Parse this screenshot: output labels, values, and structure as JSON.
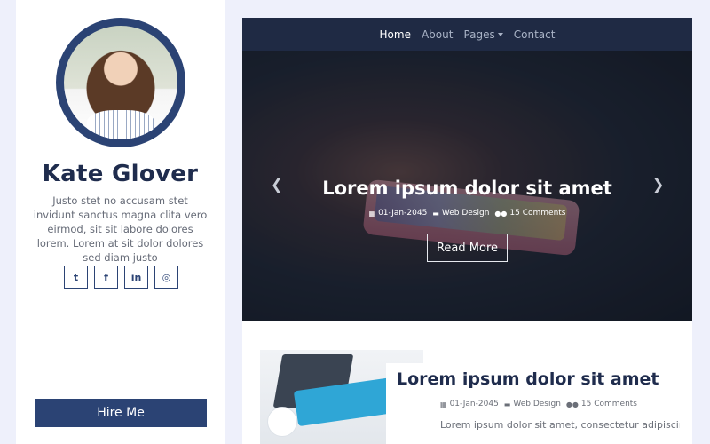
{
  "profile": {
    "name": "Kate Glover",
    "bio": "Justo stet no accusam stet invidunt sanctus magna clita vero eirmod, sit sit labore dolores lorem. Lorem at sit dolor dolores sed diam justo",
    "avatar": "profile-photo"
  },
  "socials": [
    {
      "icon": "twitter-icon",
      "glyph": "t"
    },
    {
      "icon": "facebook-icon",
      "glyph": "f"
    },
    {
      "icon": "linkedin-icon",
      "glyph": "in"
    },
    {
      "icon": "instagram-icon",
      "glyph": "◎"
    }
  ],
  "hire_label": "Hire Me",
  "nav": {
    "items": [
      "Home",
      "About",
      "Pages",
      "Contact"
    ],
    "active": "Home"
  },
  "hero": {
    "title": "Lorem ipsum dolor sit amet",
    "date": "01-Jan-2045",
    "category": "Web Design",
    "comments": "15 Comments",
    "button": "Read More",
    "prev_glyph": "❮",
    "next_glyph": "❯"
  },
  "post": {
    "title": "Lorem ipsum dolor sit amet",
    "date": "01-Jan-2045",
    "category": "Web Design",
    "comments": "15 Comments",
    "excerpt": "Lorem ipsum dolor sit amet, consectetur adipiscing"
  },
  "icons": {
    "calendar": "▦",
    "folder": "▬",
    "comments": "●●"
  },
  "colors": {
    "brand": "#2b4374",
    "navbar": "#1f2a44",
    "page_bg": "#eef0fb"
  }
}
